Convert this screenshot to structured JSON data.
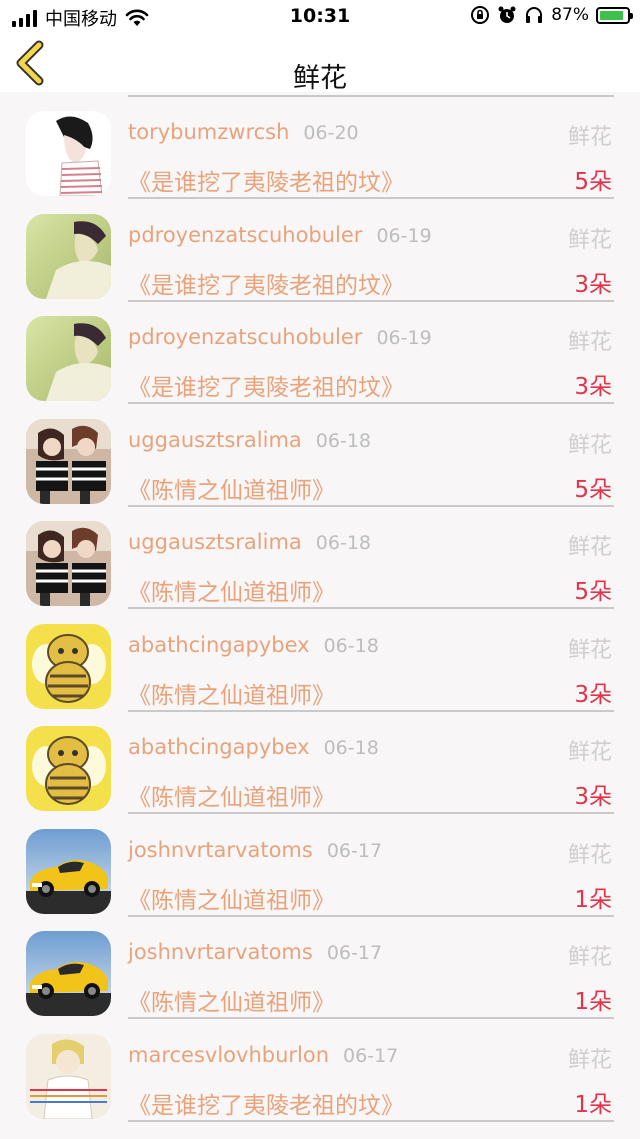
{
  "status_bar": {
    "carrier": "中国移动",
    "time": "10:31",
    "battery": "87%",
    "battery_level": 0.87,
    "icons": [
      "signal-icon",
      "wifi-icon",
      "orientation-lock-icon",
      "alarm-icon",
      "headphones-icon",
      "battery-charging-icon"
    ]
  },
  "nav": {
    "back_icon": "chevron-left-icon",
    "title": "鲜花"
  },
  "records": [
    {
      "name": "torybumzwrcsh",
      "date": "06-20",
      "gift": "鲜花",
      "book": "《是谁挖了夷陵老祖的坟》",
      "count": "5朵",
      "avatar": "sketch-boy"
    },
    {
      "name": "pdroyenzatscuhobuler",
      "date": "06-19",
      "gift": "鲜花",
      "book": "《是谁挖了夷陵老祖的坟》",
      "count": "3朵",
      "avatar": "green-boy"
    },
    {
      "name": "pdroyenzatscuhobuler",
      "date": "06-19",
      "gift": "鲜花",
      "book": "《是谁挖了夷陵老祖的坟》",
      "count": "3朵",
      "avatar": "green-boy"
    },
    {
      "name": "uggausztsralima",
      "date": "06-18",
      "gift": "鲜花",
      "book": "《陈情之仙道祖师》",
      "count": "5朵",
      "avatar": "couple"
    },
    {
      "name": "uggausztsralima",
      "date": "06-18",
      "gift": "鲜花",
      "book": "《陈情之仙道祖师》",
      "count": "5朵",
      "avatar": "couple"
    },
    {
      "name": "abathcingapybex",
      "date": "06-18",
      "gift": "鲜花",
      "book": "《陈情之仙道祖师》",
      "count": "3朵",
      "avatar": "bee"
    },
    {
      "name": "abathcingapybex",
      "date": "06-18",
      "gift": "鲜花",
      "book": "《陈情之仙道祖师》",
      "count": "3朵",
      "avatar": "bee"
    },
    {
      "name": "joshnvrtarvatoms",
      "date": "06-17",
      "gift": "鲜花",
      "book": "《陈情之仙道祖师》",
      "count": "1朵",
      "avatar": "yellow-car"
    },
    {
      "name": "joshnvrtarvatoms",
      "date": "06-17",
      "gift": "鲜花",
      "book": "《陈情之仙道祖师》",
      "count": "1朵",
      "avatar": "yellow-car"
    },
    {
      "name": "marcesvlovhburlon",
      "date": "06-17",
      "gift": "鲜花",
      "book": "《是谁挖了夷陵老祖的坟》",
      "count": "1朵",
      "avatar": "drawn-girl"
    }
  ],
  "colors": {
    "name": "#e8a37b",
    "book": "#e8a37b",
    "count": "#e0344a",
    "date": "#bdbdbd",
    "gift_label": "#cfcfcf",
    "back_arrow": "#f3d64b"
  }
}
